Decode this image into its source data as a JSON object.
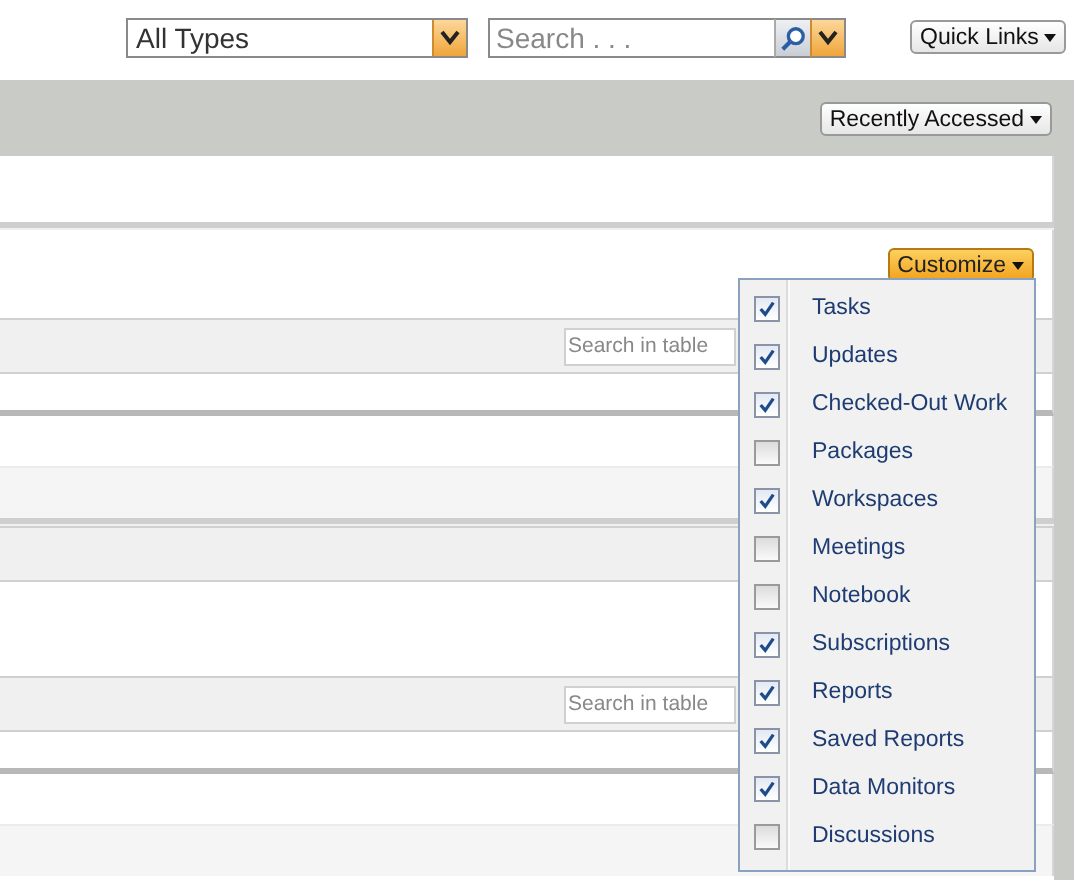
{
  "top_bar": {
    "type_select": {
      "value": "All Types"
    },
    "search": {
      "placeholder": "Search . . ."
    },
    "quick_links": "Quick Links"
  },
  "nav_bar": {
    "recently_accessed": "Recently Accessed"
  },
  "customize_button": "Customize",
  "tables": [
    {
      "search": {
        "placeholder": "Search in table"
      }
    },
    {
      "search": {
        "placeholder": "Search in table"
      }
    }
  ],
  "customize_menu": {
    "items": [
      {
        "label": "Tasks",
        "checked": true
      },
      {
        "label": "Updates",
        "checked": true
      },
      {
        "label": "Checked-Out Work",
        "checked": true
      },
      {
        "label": "Packages",
        "checked": false
      },
      {
        "label": "Workspaces",
        "checked": true
      },
      {
        "label": "Meetings",
        "checked": false
      },
      {
        "label": "Notebook",
        "checked": false
      },
      {
        "label": "Subscriptions",
        "checked": true
      },
      {
        "label": "Reports",
        "checked": true
      },
      {
        "label": "Saved Reports",
        "checked": true
      },
      {
        "label": "Data Monitors",
        "checked": true
      },
      {
        "label": "Discussions",
        "checked": false
      }
    ]
  }
}
